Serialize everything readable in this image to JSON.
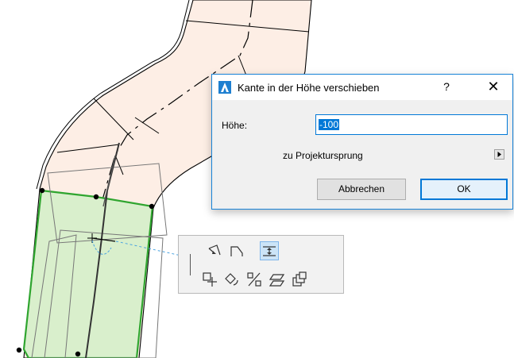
{
  "dialog": {
    "title": "Kante in der Höhe verschieben",
    "help_label": "?",
    "close_label": "✕",
    "height_label": "Höhe:",
    "height_value": "-100",
    "origin_label": "zu Projektursprung",
    "cancel_label": "Abbrechen",
    "ok_label": "OK"
  },
  "palette": {
    "row1": [
      "offset-edge-icon",
      "insert-node-icon",
      "elevate-edge-icon"
    ],
    "row2": [
      "drag-icon",
      "rotate-icon",
      "mirror-icon",
      "elevate-icon",
      "multiply-icon"
    ]
  },
  "colors": {
    "slab_fill": "#fdeee5",
    "selected_fill": "#d9efcc",
    "selected_outline": "#2fa52f",
    "accent": "#0078d7"
  }
}
